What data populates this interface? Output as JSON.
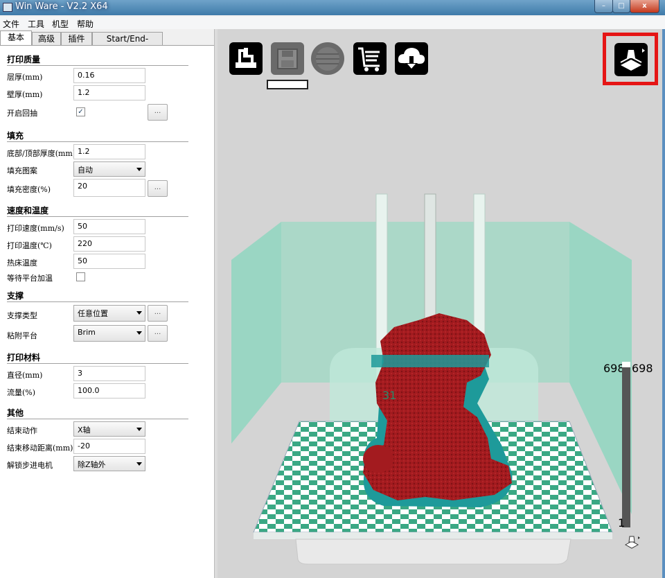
{
  "window": {
    "title": "Win Ware - V2.2 X64",
    "controls": {
      "minimize": "–",
      "maximize": "□",
      "close": "x"
    }
  },
  "menu": [
    "文件",
    "工具",
    "机型",
    "帮助"
  ],
  "tabs": [
    "基本",
    "高级",
    "插件",
    "Start/End-GCode"
  ],
  "sections": {
    "print_quality": {
      "title": "打印质量",
      "layer_height": {
        "label": "层厚(mm)",
        "value": "0.16"
      },
      "shell_thickness": {
        "label": "壁厚(mm)",
        "value": "1.2"
      },
      "retraction": {
        "label": "开启回抽",
        "checked": true
      }
    },
    "fill": {
      "title": "填充",
      "bottom_top": {
        "label": "底部/顶部厚度(mm)",
        "value": "1.2"
      },
      "pattern": {
        "label": "填充图案",
        "value": "自动"
      },
      "density": {
        "label": "填充密度(%)",
        "value": "20"
      }
    },
    "speed_temp": {
      "title": "速度和温度",
      "print_speed": {
        "label": "打印速度(mm/s)",
        "value": "50"
      },
      "print_temp": {
        "label": "打印温度(℃)",
        "value": "220"
      },
      "bed_temp": {
        "label": "热床温度",
        "value": "50"
      },
      "wait_bed": {
        "label": "等待平台加温",
        "checked": false
      }
    },
    "support": {
      "title": "支撑",
      "support_type": {
        "label": "支撑类型",
        "value": "任意位置"
      },
      "adhesion": {
        "label": "粘附平台",
        "value": "Brim"
      }
    },
    "material": {
      "title": "打印材料",
      "diameter": {
        "label": "直径(mm)",
        "value": "3"
      },
      "flow": {
        "label": "流量(%)",
        "value": "100.0"
      }
    },
    "other": {
      "title": "其他",
      "end_action": {
        "label": "结束动作",
        "value": "X轴"
      },
      "end_distance": {
        "label": "结束移动距离(mm)",
        "value": "-20"
      },
      "unlock_motor": {
        "label": "解锁步进电机",
        "value": "除Z轴外"
      }
    }
  },
  "dots_label": "...",
  "viewport": {
    "layer_top_left": "698",
    "layer_top_right": "698",
    "layer_bottom": "1",
    "bed_text": "31",
    "colors": {
      "model": "#a31b1f",
      "model_shadow": "#1e9a9a",
      "volume": "#8fd6c0",
      "bed_checker": "#3aa884"
    }
  }
}
